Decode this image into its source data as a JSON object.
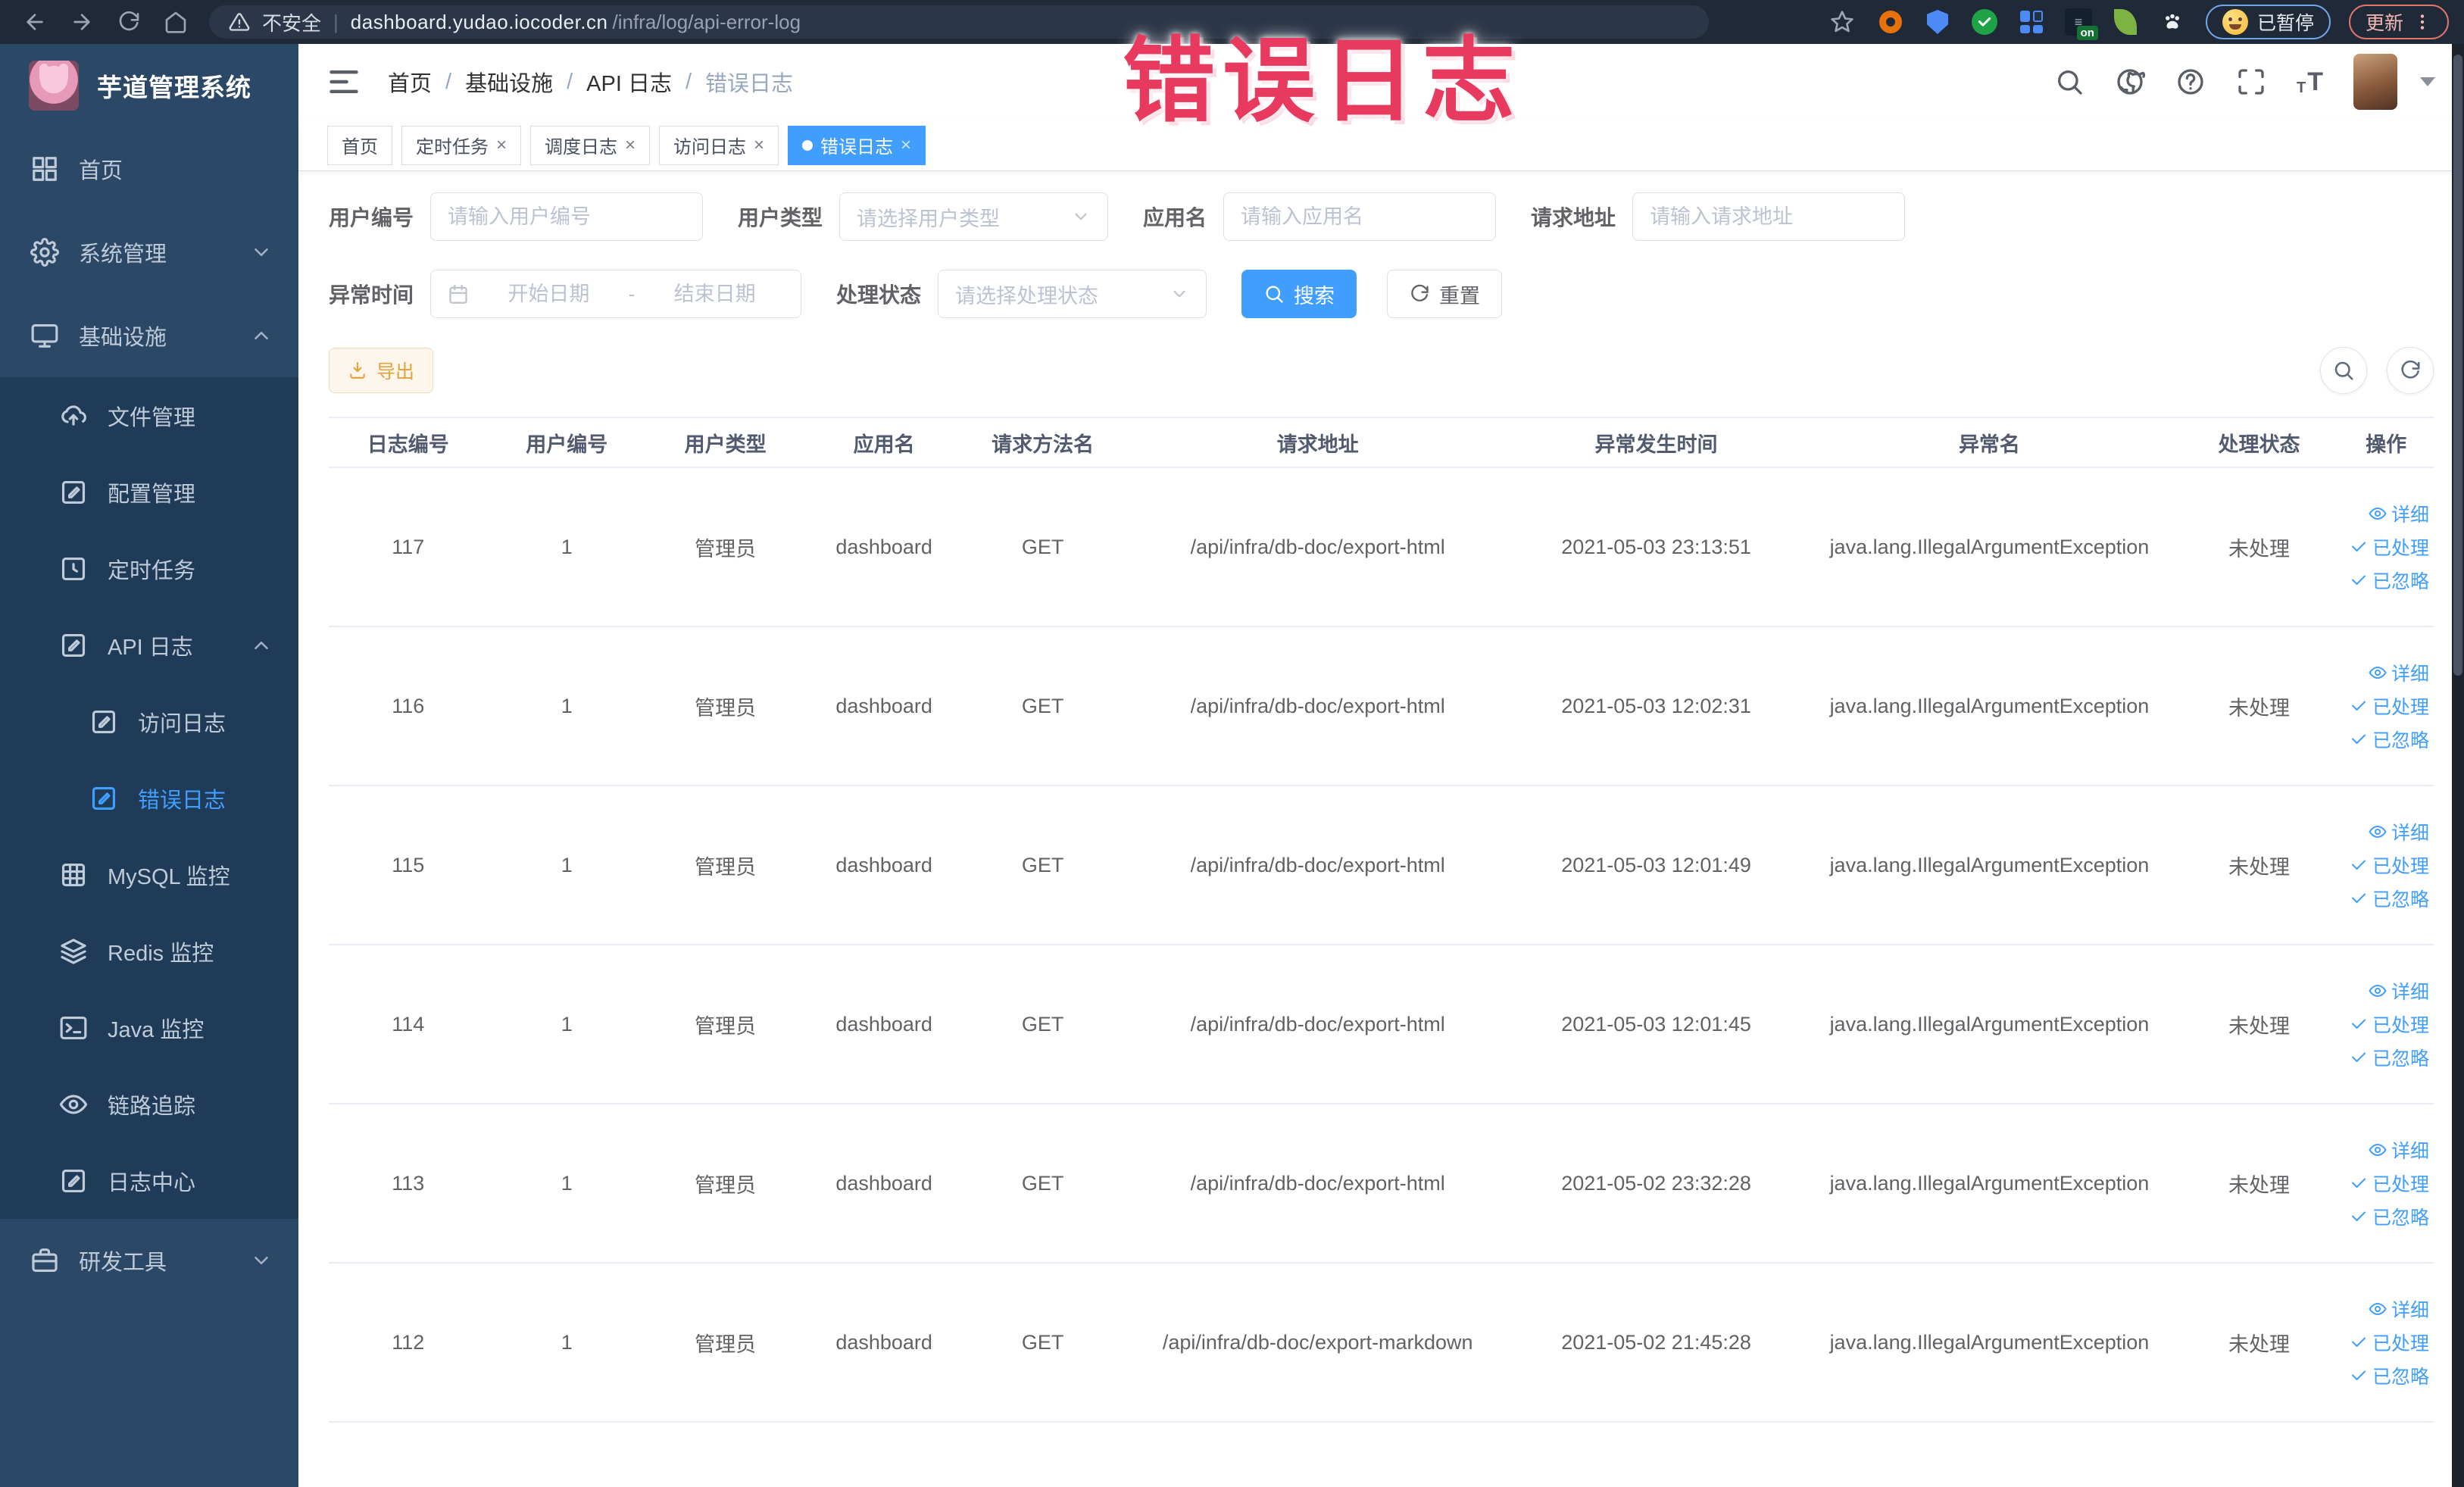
{
  "browser": {
    "security_label": "不安全",
    "url_domain": "dashboard.yudao.iocoder.cn",
    "url_path": "/infra/log/api-error-log",
    "paused_label": "已暂停",
    "update_label": "更新",
    "extensions": [
      {
        "id": "ext-orange-donut",
        "type": "donut"
      },
      {
        "id": "ext-blue-shield",
        "type": "shield"
      },
      {
        "id": "ext-green-check",
        "type": "circle-check"
      },
      {
        "id": "ext-blue-grid",
        "type": "grid"
      },
      {
        "id": "ext-on-toggle",
        "type": "badge",
        "label": "on"
      },
      {
        "id": "ext-green-leaf",
        "type": "leaf"
      },
      {
        "id": "ext-white-paw",
        "type": "paw"
      }
    ]
  },
  "annotation": {
    "text": "错误日志",
    "color": "#e8395e"
  },
  "sidebar": {
    "logo_title": "芋道管理系统",
    "items": [
      {
        "id": "home",
        "label": "首页",
        "icon": "dash",
        "level": 0,
        "panel": false
      },
      {
        "id": "system",
        "label": "系统管理",
        "icon": "gear",
        "level": 0,
        "panel": false,
        "chevron": "down"
      },
      {
        "id": "infra",
        "label": "基础设施",
        "icon": "monitor",
        "level": 0,
        "panel": false,
        "chevron": "up"
      },
      {
        "id": "file",
        "label": "文件管理",
        "icon": "cloud",
        "level": 1,
        "panel": true
      },
      {
        "id": "config",
        "label": "配置管理",
        "icon": "editsq",
        "level": 1,
        "panel": true
      },
      {
        "id": "job",
        "label": "定时任务",
        "icon": "clocksq",
        "level": 1,
        "panel": true
      },
      {
        "id": "api-log",
        "label": "API 日志",
        "icon": "editsq",
        "level": 1,
        "panel": true,
        "chevron": "up"
      },
      {
        "id": "access-log",
        "label": "访问日志",
        "icon": "editsq",
        "level": 2,
        "panel": true
      },
      {
        "id": "error-log",
        "label": "错误日志",
        "icon": "editsq",
        "level": 2,
        "panel": true,
        "active": true
      },
      {
        "id": "mysql",
        "label": "MySQL 监控",
        "icon": "gridtbl",
        "level": 1,
        "panel": true
      },
      {
        "id": "redis",
        "label": "Redis 监控",
        "icon": "layers",
        "level": 1,
        "panel": true
      },
      {
        "id": "java",
        "label": "Java 监控",
        "icon": "terminal",
        "level": 1,
        "panel": true
      },
      {
        "id": "trace",
        "label": "链路追踪",
        "icon": "eye",
        "level": 1,
        "panel": true
      },
      {
        "id": "log-center",
        "label": "日志中心",
        "icon": "editsq",
        "level": 1,
        "panel": true
      },
      {
        "id": "dev-tools",
        "label": "研发工具",
        "icon": "briefcase",
        "level": 0,
        "panel": false,
        "chevron": "down"
      }
    ]
  },
  "header": {
    "breadcrumb": [
      "首页",
      "基础设施",
      "API 日志",
      "错误日志"
    ]
  },
  "tabs": [
    {
      "label": "首页",
      "closable": false,
      "active": false
    },
    {
      "label": "定时任务",
      "closable": true,
      "active": false
    },
    {
      "label": "调度日志",
      "closable": true,
      "active": false
    },
    {
      "label": "访问日志",
      "closable": true,
      "active": false
    },
    {
      "label": "错误日志",
      "closable": true,
      "active": true
    }
  ],
  "filters": {
    "user_id": {
      "label": "用户编号",
      "placeholder": "请输入用户编号"
    },
    "user_type": {
      "label": "用户类型",
      "placeholder": "请选择用户类型"
    },
    "app_name": {
      "label": "应用名",
      "placeholder": "请输入应用名"
    },
    "request_url": {
      "label": "请求地址",
      "placeholder": "请输入请求地址"
    },
    "exception_time": {
      "label": "异常时间",
      "start_placeholder": "开始日期",
      "separator": "-",
      "end_placeholder": "结束日期"
    },
    "process_status": {
      "label": "处理状态",
      "placeholder": "请选择处理状态"
    },
    "search_label": "搜索",
    "reset_label": "重置"
  },
  "toolbar": {
    "export_label": "导出"
  },
  "table": {
    "columns": [
      "日志编号",
      "用户编号",
      "用户类型",
      "应用名",
      "请求方法名",
      "请求地址",
      "异常发生时间",
      "异常名",
      "处理状态",
      "操作"
    ],
    "col_widths": [
      "7.5%",
      "7.5%",
      "7.5%",
      "7.5%",
      "7.5%",
      "18.5%",
      "13.5%",
      "18%",
      "7.5%",
      "4.5%"
    ],
    "actions": [
      {
        "label": "详细",
        "icon": "eye"
      },
      {
        "label": "已处理",
        "icon": "check"
      },
      {
        "label": "已忽略",
        "icon": "check"
      }
    ],
    "rows": [
      {
        "id": "117",
        "user_id": "1",
        "user_type": "管理员",
        "app": "dashboard",
        "method": "GET",
        "url": "/api/infra/db-doc/export-html",
        "time": "2021-05-03 23:13:51",
        "exception": "java.lang.IllegalArgumentException",
        "status": "未处理"
      },
      {
        "id": "116",
        "user_id": "1",
        "user_type": "管理员",
        "app": "dashboard",
        "method": "GET",
        "url": "/api/infra/db-doc/export-html",
        "time": "2021-05-03 12:02:31",
        "exception": "java.lang.IllegalArgumentException",
        "status": "未处理"
      },
      {
        "id": "115",
        "user_id": "1",
        "user_type": "管理员",
        "app": "dashboard",
        "method": "GET",
        "url": "/api/infra/db-doc/export-html",
        "time": "2021-05-03 12:01:49",
        "exception": "java.lang.IllegalArgumentException",
        "status": "未处理"
      },
      {
        "id": "114",
        "user_id": "1",
        "user_type": "管理员",
        "app": "dashboard",
        "method": "GET",
        "url": "/api/infra/db-doc/export-html",
        "time": "2021-05-03 12:01:45",
        "exception": "java.lang.IllegalArgumentException",
        "status": "未处理"
      },
      {
        "id": "113",
        "user_id": "1",
        "user_type": "管理员",
        "app": "dashboard",
        "method": "GET",
        "url": "/api/infra/db-doc/export-html",
        "time": "2021-05-02 23:32:28",
        "exception": "java.lang.IllegalArgumentException",
        "status": "未处理"
      },
      {
        "id": "112",
        "user_id": "1",
        "user_type": "管理员",
        "app": "dashboard",
        "method": "GET",
        "url": "/api/infra/db-doc/export-markdown",
        "time": "2021-05-02 21:45:28",
        "exception": "java.lang.IllegalArgumentException",
        "status": "未处理"
      }
    ]
  },
  "colors": {
    "accent": "#409eff",
    "warning": "#e6a23c",
    "sidebar_bg": "#2b4866",
    "submenu_bg": "#1f3b58"
  }
}
